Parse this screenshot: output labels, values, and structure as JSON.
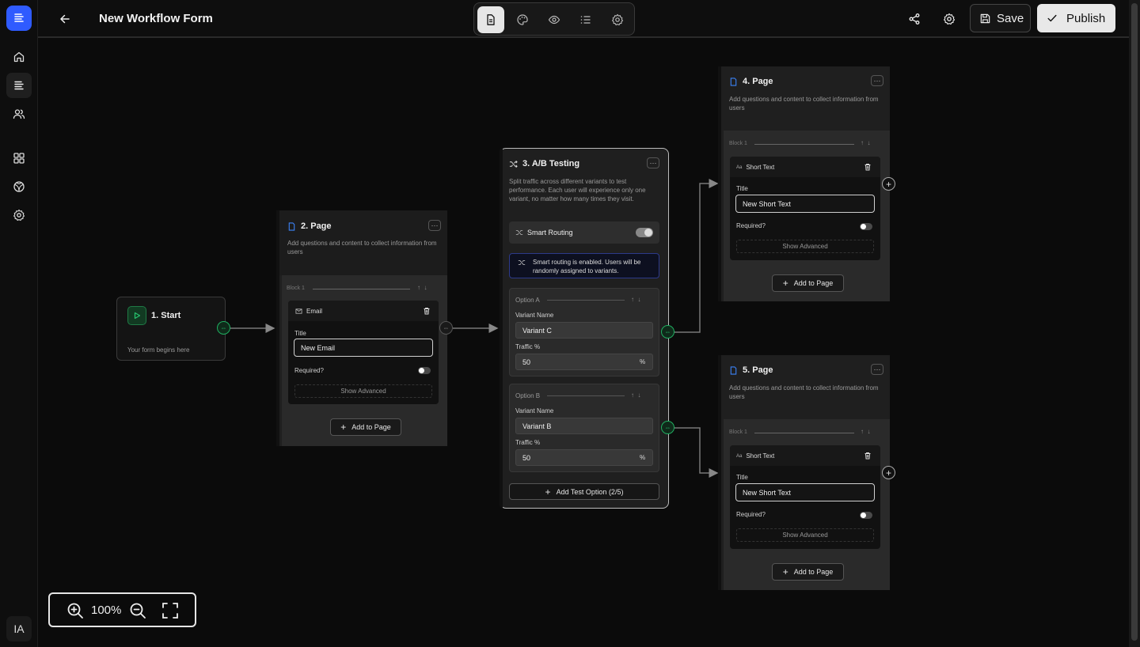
{
  "app": {
    "avatar_initials": "IA",
    "accent": "#2f5bff",
    "success": "#27c46e"
  },
  "sidebar": {
    "items": [
      {
        "icon": "home-icon"
      },
      {
        "icon": "forms-icon",
        "active": true
      },
      {
        "icon": "users-icon"
      },
      {
        "icon": "grid-icon"
      },
      {
        "icon": "globe-icon"
      },
      {
        "icon": "settings-icon"
      }
    ]
  },
  "header": {
    "title": "New Workflow Form",
    "modes": [
      "document-icon",
      "palette-icon",
      "eye-icon",
      "list-icon",
      "gear-icon"
    ],
    "save_label": "Save",
    "publish_label": "Publish"
  },
  "nodes": {
    "start": {
      "title": "1. Start",
      "desc": "Your form begins here"
    },
    "page2": {
      "title": "2. Page",
      "desc": "Add questions and content to collect information from users",
      "block_label": "Block 1",
      "field_type": "Email",
      "title_label": "Title",
      "title_value": "New Email",
      "required_label": "Required?",
      "advanced_label": "Show Advanced",
      "add_label": "Add to Page"
    },
    "ab": {
      "title": "3. A/B Testing",
      "desc": "Split traffic across different variants to test performance. Each user will experience only one variant, no matter how many times they visit.",
      "smart_label": "Smart Routing",
      "info": "Smart routing is enabled. Users will be randomly assigned to variants.",
      "options": [
        {
          "label": "Option A",
          "name_label": "Variant Name",
          "name": "Variant C",
          "traffic_label": "Traffic %",
          "traffic": "50",
          "unit": "%"
        },
        {
          "label": "Option B",
          "name_label": "Variant Name",
          "name": "Variant B",
          "traffic_label": "Traffic %",
          "traffic": "50",
          "unit": "%"
        }
      ],
      "add_option_label": "Add Test Option (2/5)"
    },
    "page4": {
      "title": "4. Page",
      "desc": "Add questions and content to collect information from users",
      "block_label": "Block 1",
      "field_type": "Short Text",
      "title_label": "Title",
      "title_value": "New Short Text",
      "required_label": "Required?",
      "advanced_label": "Show Advanced",
      "add_label": "Add to Page"
    },
    "page5": {
      "title": "5. Page",
      "desc": "Add questions and content to collect information from users",
      "block_label": "Block 1",
      "field_type": "Short Text",
      "title_label": "Title",
      "title_value": "New Short Text",
      "required_label": "Required?",
      "advanced_label": "Show Advanced",
      "add_label": "Add to Page"
    }
  },
  "zoom": {
    "level": "100%"
  }
}
